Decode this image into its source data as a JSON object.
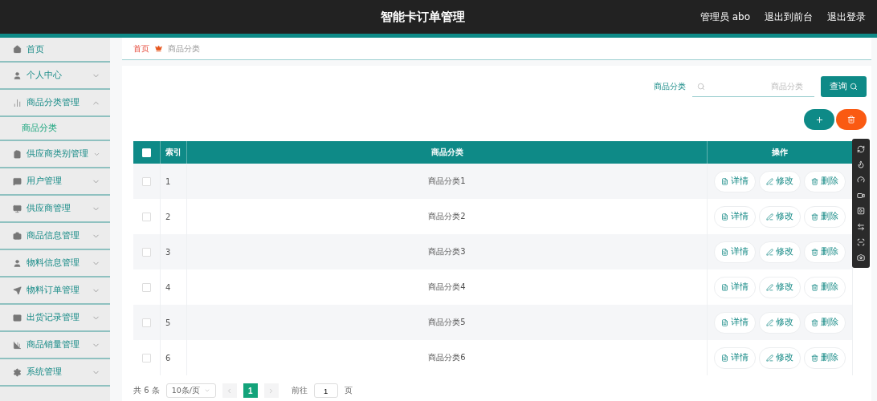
{
  "header": {
    "title": "智能卡订单管理",
    "user": "管理员 abo",
    "links": [
      "退出到前台",
      "退出登录"
    ]
  },
  "sidebar": {
    "items": [
      {
        "label": "首页",
        "kind": "link"
      },
      {
        "label": "个人中心",
        "kind": "menu",
        "expanded": false
      },
      {
        "label": "商品分类管理",
        "kind": "menu",
        "expanded": true,
        "children": [
          {
            "label": "商品分类",
            "selected": true
          }
        ]
      },
      {
        "label": "供应商类别管理",
        "kind": "menu",
        "expanded": false
      },
      {
        "label": "用户管理",
        "kind": "menu",
        "expanded": false
      },
      {
        "label": "供应商管理",
        "kind": "menu",
        "expanded": false
      },
      {
        "label": "商品信息管理",
        "kind": "menu",
        "expanded": false
      },
      {
        "label": "物料信息管理",
        "kind": "menu",
        "expanded": false
      },
      {
        "label": "物料订单管理",
        "kind": "menu",
        "expanded": false
      },
      {
        "label": "出货记录管理",
        "kind": "menu",
        "expanded": false
      },
      {
        "label": "商品销量管理",
        "kind": "menu",
        "expanded": false
      },
      {
        "label": "系统管理",
        "kind": "menu",
        "expanded": false
      }
    ]
  },
  "breadcrumb": [
    "首页",
    "商品分类"
  ],
  "search": {
    "label": "商品分类",
    "placeholder": "商品分类",
    "button": "查询"
  },
  "table": {
    "select_all_checked": false,
    "columns": [
      "索引",
      "商品分类",
      "操作"
    ],
    "rows": [
      {
        "index": "1",
        "name": "商品分类1",
        "checked": false,
        "actions": [
          "详情",
          "修改",
          "删除"
        ]
      },
      {
        "index": "2",
        "name": "商品分类2",
        "checked": false,
        "actions": [
          "详情",
          "修改",
          "删除"
        ]
      },
      {
        "index": "3",
        "name": "商品分类3",
        "checked": false,
        "actions": [
          "详情",
          "修改",
          "删除"
        ]
      },
      {
        "index": "4",
        "name": "商品分类4",
        "checked": false,
        "actions": [
          "详情",
          "修改",
          "删除"
        ]
      },
      {
        "index": "5",
        "name": "商品分类5",
        "checked": false,
        "actions": [
          "详情",
          "修改",
          "删除"
        ]
      },
      {
        "index": "6",
        "name": "商品分类6",
        "checked": false,
        "actions": [
          "详情",
          "修改",
          "删除"
        ]
      }
    ]
  },
  "pagination": {
    "total": "共 6 条",
    "page_size": "10条/页",
    "pages": [
      {
        "label": "1",
        "selected": true
      }
    ],
    "goto_label": "前往",
    "goto_value": "1",
    "goto_suffix": "页"
  }
}
